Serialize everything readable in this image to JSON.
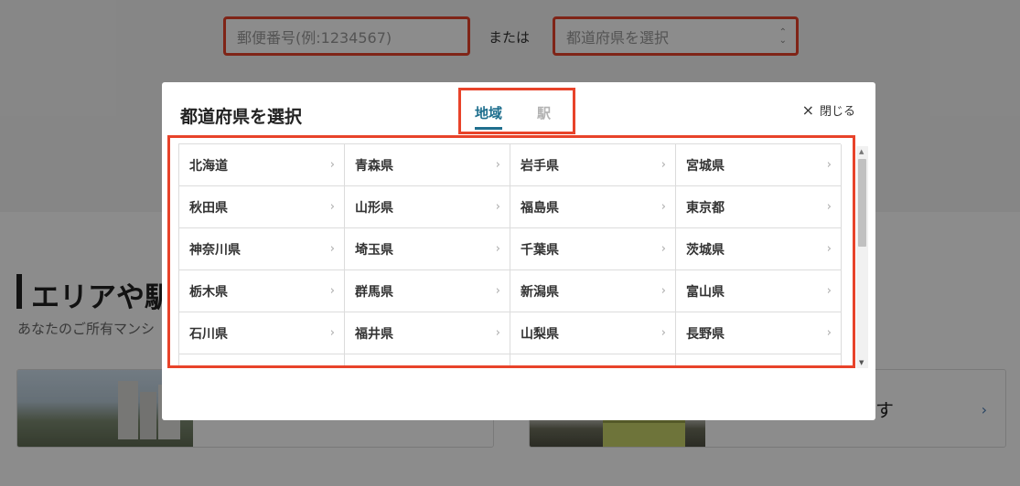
{
  "search": {
    "postal_placeholder": "郵便番号(例:1234567)",
    "or_label": "または",
    "prefecture_placeholder": "都道府県を選択"
  },
  "section": {
    "title": "エリアや駅",
    "subtitle": "あなたのご所有マンシ"
  },
  "card": {
    "text": "す",
    "chevron": "›"
  },
  "modal": {
    "title": "都道府県を選択",
    "tabs": {
      "region": "地域",
      "station": "駅"
    },
    "close_label": "閉じる",
    "close_icon": "×",
    "chevron": "›",
    "prefectures": [
      "北海道",
      "青森県",
      "岩手県",
      "宮城県",
      "秋田県",
      "山形県",
      "福島県",
      "東京都",
      "神奈川県",
      "埼玉県",
      "千葉県",
      "茨城県",
      "栃木県",
      "群馬県",
      "新潟県",
      "富山県",
      "石川県",
      "福井県",
      "山梨県",
      "長野県",
      "",
      "",
      "",
      ""
    ]
  },
  "colors": {
    "highlight_border": "#e8432a",
    "active_tab": "#1f6f8e"
  }
}
